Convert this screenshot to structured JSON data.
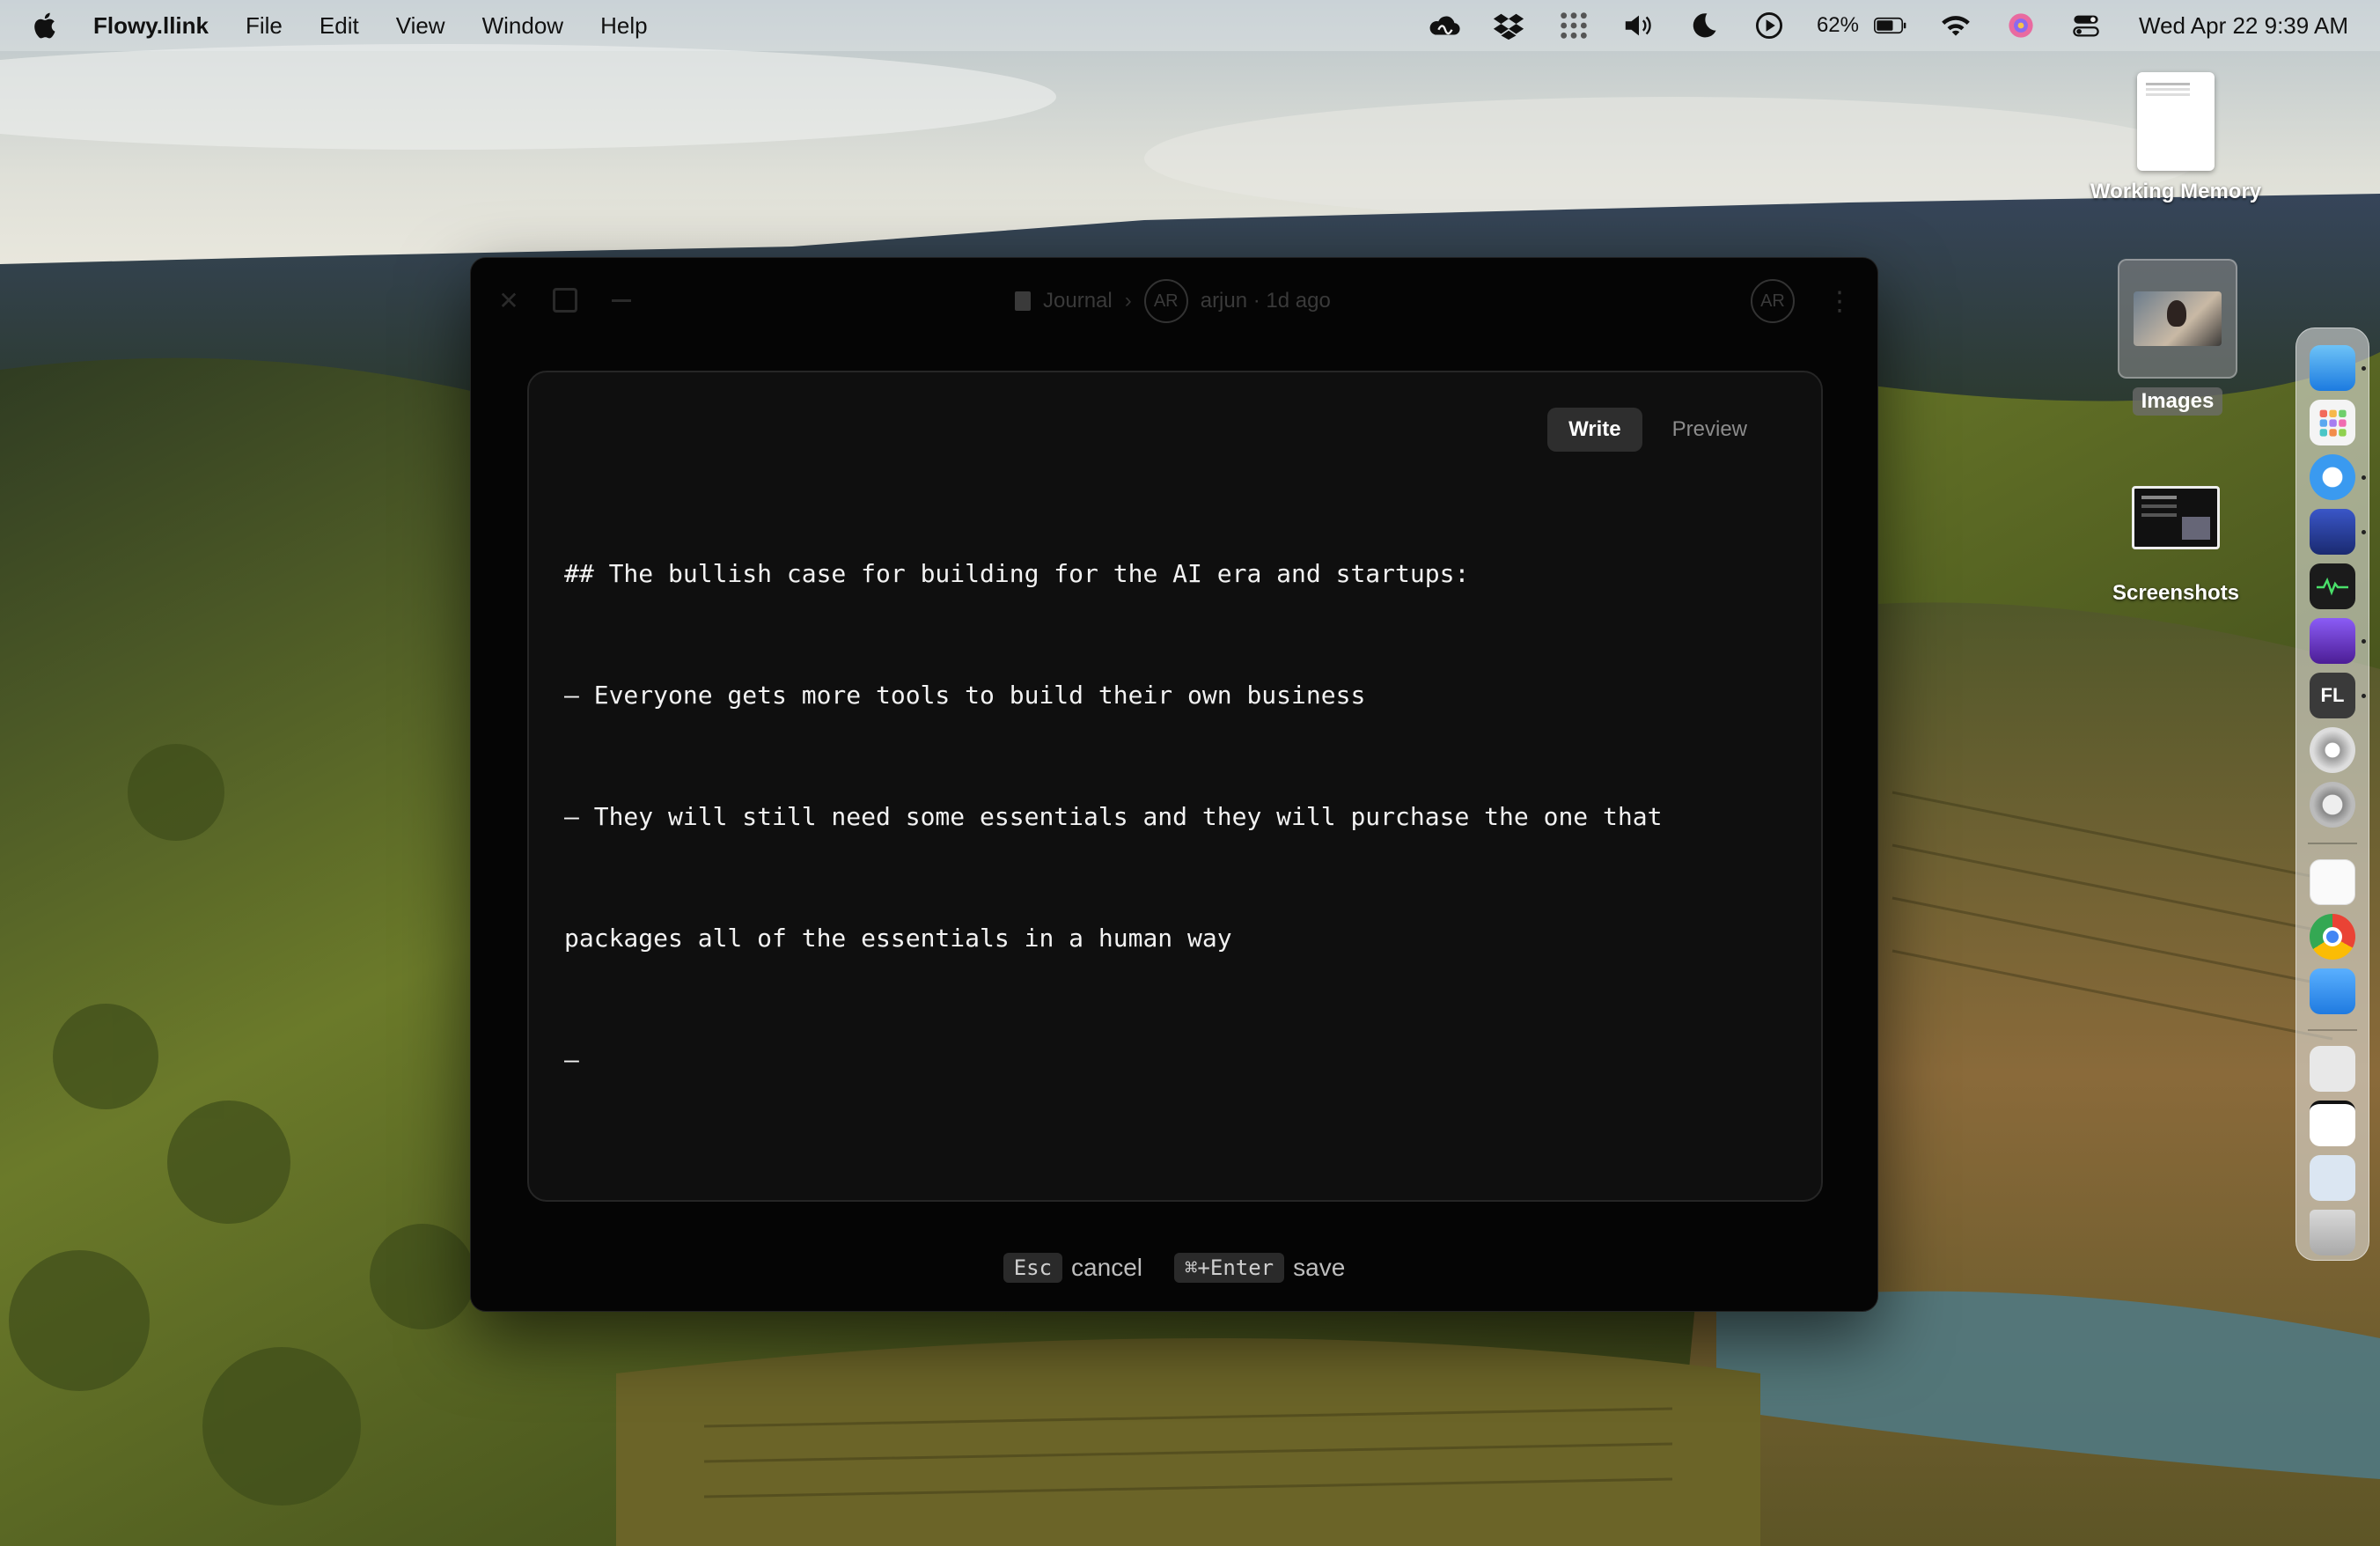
{
  "menubar": {
    "app_name": "Flowy.llink",
    "menus": [
      "File",
      "Edit",
      "View",
      "Window",
      "Help"
    ],
    "battery_percent": "62%",
    "clock": "Wed Apr 22  9:39 AM",
    "status_icons": [
      "creative-cloud-icon",
      "dropbox-icon",
      "grid-dots-icon",
      "volume-icon",
      "moon-icon",
      "play-circle-icon",
      "battery-icon",
      "wifi-icon",
      "siri-icon",
      "control-center-icon"
    ]
  },
  "desktop": {
    "items": [
      {
        "label": "Working Memory",
        "kind": "document"
      },
      {
        "label": "Images",
        "kind": "folder-preview"
      },
      {
        "label": "Screenshots",
        "kind": "folder-preview"
      }
    ]
  },
  "dock": {
    "apps": [
      "finder",
      "launchpad",
      "safari",
      "app-blue",
      "activity-monitor",
      "obsidian",
      "fl-studio",
      "disk-utility",
      "system-settings",
      "notes",
      "chrome",
      "icloud",
      "preview",
      "document",
      "file",
      "trash"
    ]
  },
  "window": {
    "breadcrumb": {
      "notebook": "Journal",
      "author_initials": "AR",
      "meta": "arjun · 1d ago"
    },
    "right_avatar": "AR",
    "modes": {
      "write": "Write",
      "preview": "Preview"
    },
    "content_lines": [
      "## The bullish case for building for the AI era and startups:",
      "– Everyone gets more tools to build their own business",
      "– They will still need some essentials and they will purchase the one that",
      "packages all of the essentials in a human way",
      "–"
    ],
    "footer": {
      "cancel_key": "Esc",
      "cancel_label": "cancel",
      "save_key": "⌘+Enter",
      "save_label": "save"
    }
  },
  "colors": {
    "window_bg": "#050505",
    "editor_bg": "#0f0f0f",
    "active_toggle": "#2e2e2e",
    "text": "#f2f2f2"
  }
}
